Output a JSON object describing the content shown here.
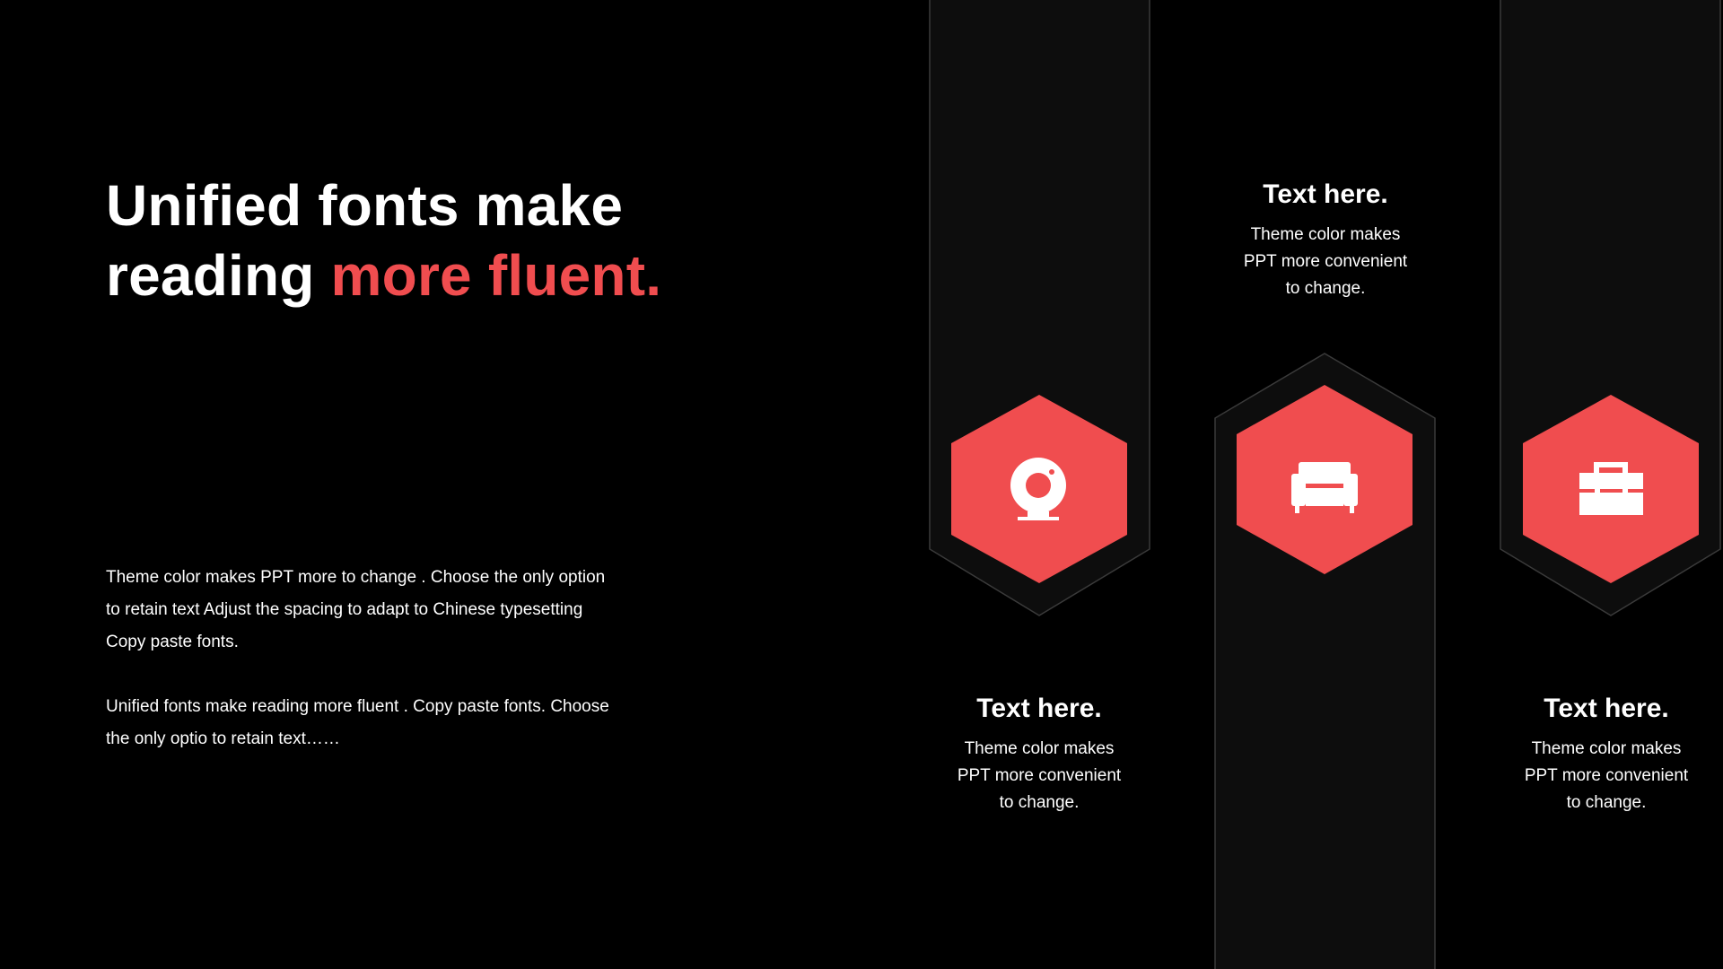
{
  "headline": {
    "line1": "Unified fonts make",
    "line2_plain": "reading ",
    "line2_accent": "more fluent."
  },
  "body": {
    "para1_line1": "Theme  color makes PPT more to change . Choose the only option",
    "para1_line2": "to retain text Adjust the spacing to adapt to Chinese typesetting",
    "para1_line3": "Copy paste fonts.",
    "para2_line1": "Unified fonts make reading more fluent . Copy paste fonts. Choose",
    "para2_line2": "the only optio to retain text……"
  },
  "cards": [
    {
      "title": "Text here.",
      "desc_line1": "Theme  color makes",
      "desc_line2": "PPT more convenient",
      "desc_line3": "to change.",
      "icon": "webcam-icon"
    },
    {
      "title": "Text here.",
      "desc_line1": "Theme  color makes",
      "desc_line2": "PPT more convenient",
      "desc_line3": "to change.",
      "icon": "sofa-icon"
    },
    {
      "title": "Text here.",
      "desc_line1": "Theme  color makes",
      "desc_line2": "PPT more convenient",
      "desc_line3": "to change.",
      "icon": "toolbox-icon"
    }
  ],
  "colors": {
    "background": "#000000",
    "accent": "#f04d4f",
    "column_fill": "#0d0d0d",
    "column_stroke": "#3a3a3a",
    "text": "#ffffff"
  }
}
